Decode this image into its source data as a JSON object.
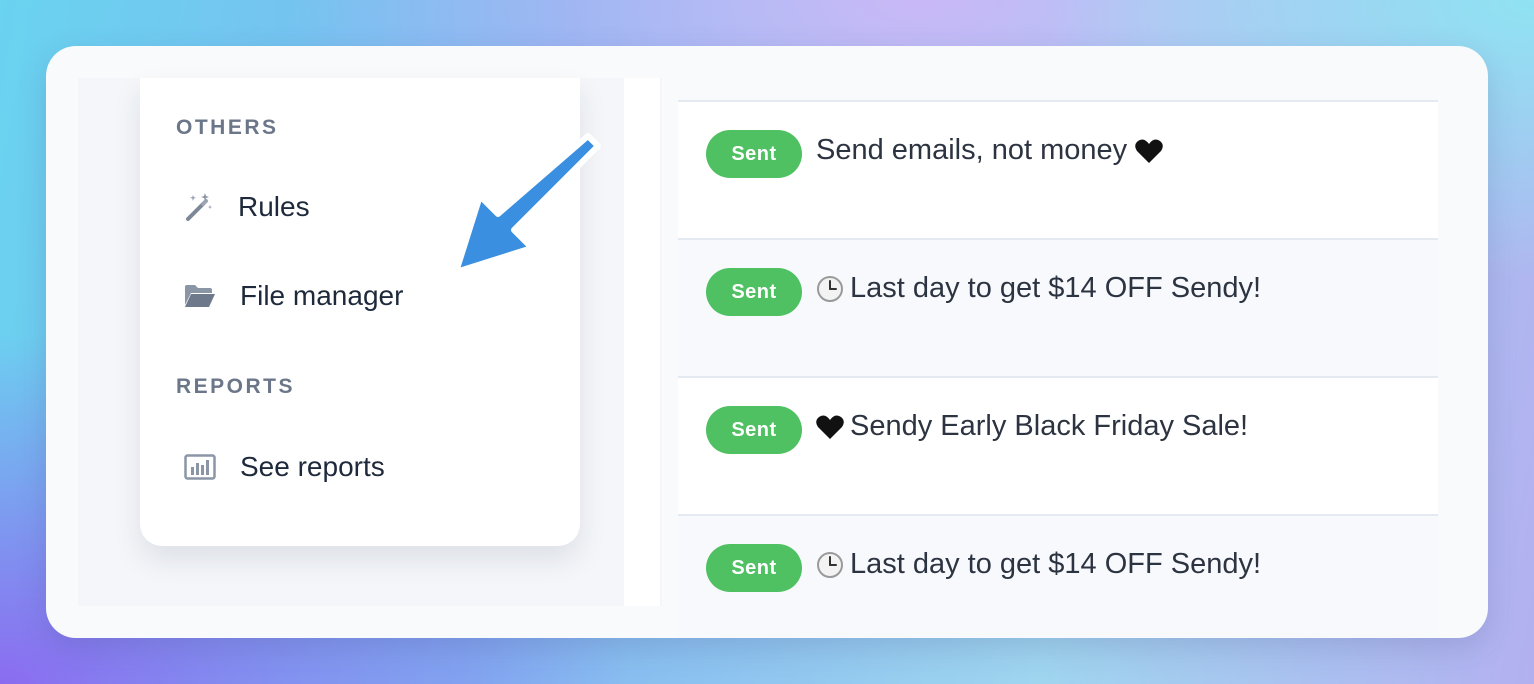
{
  "sidebar": {
    "sections": [
      {
        "heading": "OTHERS",
        "items": [
          {
            "label": "Rules",
            "icon": "magic-wand-icon"
          },
          {
            "label": "File manager",
            "icon": "folder-open-icon"
          }
        ]
      },
      {
        "heading": "REPORTS",
        "items": [
          {
            "label": "See reports",
            "icon": "bar-chart-icon"
          }
        ]
      }
    ]
  },
  "annotation": {
    "icon": "arrow-pointer-icon",
    "color": "#3a8fe0"
  },
  "campaigns": [
    {
      "status": "Sent",
      "subject": "Send emails, not money",
      "emoji_after": "black-heart-icon"
    },
    {
      "status": "Sent",
      "subject": "Last day to get $14 OFF Sendy!",
      "emoji_before": "clock-icon"
    },
    {
      "status": "Sent",
      "subject": "Sendy Early Black Friday Sale!",
      "emoji_before": "black-heart-icon"
    },
    {
      "status": "Sent",
      "subject": "Last day to get $14 OFF Sendy!",
      "emoji_before": "clock-icon"
    }
  ],
  "colors": {
    "badge": "#4fc162",
    "heading": "#6b7789",
    "nav_text": "#1e2a3b"
  }
}
